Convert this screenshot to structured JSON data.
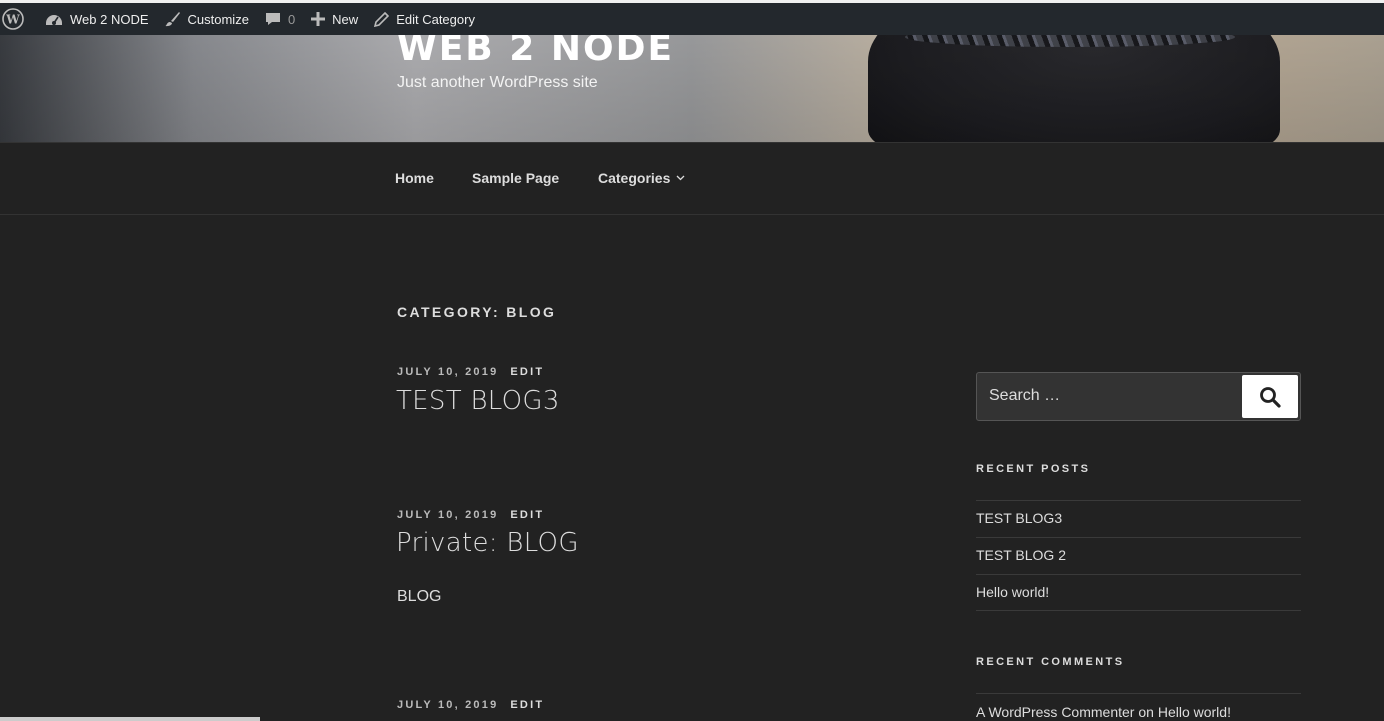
{
  "adminbar": {
    "site_name": "Web 2 NODE",
    "customize": "Customize",
    "comments_count": "0",
    "new": "New",
    "edit_category": "Edit Category"
  },
  "header": {
    "title": "WEB 2 NODE",
    "description": "Just another WordPress site"
  },
  "nav": {
    "items": [
      "Home",
      "Sample Page",
      "Categories"
    ]
  },
  "main": {
    "page_title": "CATEGORY: BLOG",
    "posts": [
      {
        "date": "JULY 10, 2019",
        "edit": "EDIT",
        "title": "TEST BLOG3",
        "excerpt": ""
      },
      {
        "date": "JULY 10, 2019",
        "edit": "EDIT",
        "title": "Private: BLOG",
        "excerpt": "BLOG"
      },
      {
        "date": "JULY 10, 2019",
        "edit": "EDIT",
        "title": "",
        "excerpt": ""
      }
    ]
  },
  "sidebar": {
    "search_placeholder": "Search …",
    "recent_posts_title": "RECENT POSTS",
    "recent_posts": [
      "TEST BLOG3",
      "TEST BLOG 2",
      "Hello world!"
    ],
    "recent_comments_title": "RECENT COMMENTS",
    "comment": {
      "author": "A WordPress Commenter",
      "on": "on",
      "post": "Hello world!"
    }
  },
  "colors": {
    "background": "#222222",
    "adminbar": "#23282d",
    "text": "#dddddd"
  }
}
